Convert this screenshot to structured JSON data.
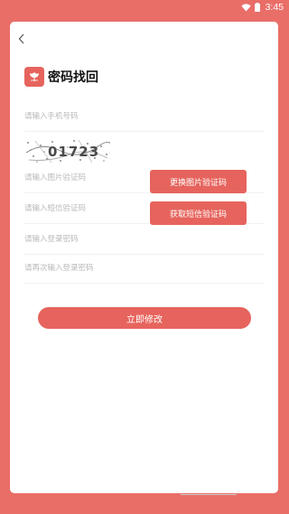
{
  "status_bar": {
    "time": "3:45"
  },
  "header": {
    "title": "密码找回"
  },
  "form": {
    "phone_placeholder": "请输入手机号码",
    "captcha_text": "01723",
    "image_code_placeholder": "请输入图片验证码",
    "sms_code_placeholder": "请输入短信验证码",
    "password_placeholder": "请输入登录密码",
    "password_confirm_placeholder": "请再次输入登录密码"
  },
  "buttons": {
    "refresh_captcha": "更换图片验证码",
    "get_sms_code": "获取短信验证码",
    "submit": "立即修改"
  },
  "colors": {
    "background": "#ea6e68",
    "accent": "#e6645d",
    "card": "#ffffff"
  },
  "icons": {
    "back": "chevron-left-icon",
    "wifi": "wifi-icon",
    "battery": "battery-icon",
    "logo": "flower-logo-icon"
  }
}
